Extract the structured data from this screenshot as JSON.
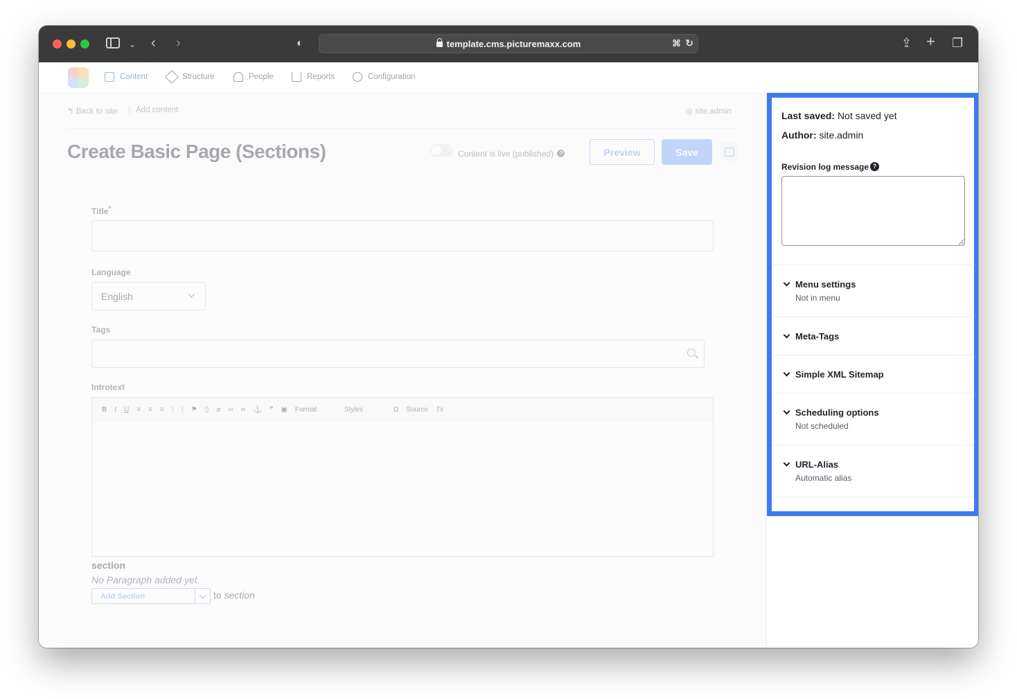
{
  "browser": {
    "url": "template.cms.picturemaxx.com"
  },
  "nav": {
    "items": [
      {
        "label": "Content",
        "icon": "document-icon",
        "active": true
      },
      {
        "label": "Structure",
        "icon": "layers-icon"
      },
      {
        "label": "People",
        "icon": "person-icon"
      },
      {
        "label": "Reports",
        "icon": "bar-chart-icon"
      },
      {
        "label": "Configuration",
        "icon": "gear-icon"
      }
    ]
  },
  "breadcrumb": {
    "back": "Back to site",
    "current": "Add content",
    "user": "site.admin"
  },
  "page": {
    "title": "Create Basic Page (Sections)",
    "live_label": "Content is live (published)",
    "preview_label": "Preview",
    "save_label": "Save"
  },
  "form": {
    "title_label": "Title",
    "title_required": "*",
    "language_label": "Language",
    "language_value": "English",
    "tags_label": "Tags",
    "introtext_label": "Introtext",
    "editor_toolbar": {
      "format": "Format",
      "styles": "Styles",
      "source": "Source"
    },
    "section_title": "section",
    "section_empty": "No Paragraph added yet.",
    "add_section_label": "Add Section",
    "to_label": "to",
    "to_target": "section"
  },
  "sidebar": {
    "last_saved_label": "Last saved:",
    "last_saved_value": "Not saved yet",
    "author_label": "Author:",
    "author_value": "site.admin",
    "revision_label": "Revision log message",
    "accordions": [
      {
        "title": "Menu settings",
        "subtitle": "Not in menu"
      },
      {
        "title": "Meta-Tags",
        "subtitle": ""
      },
      {
        "title": "Simple XML Sitemap",
        "subtitle": ""
      },
      {
        "title": "Scheduling options",
        "subtitle": "Not scheduled"
      },
      {
        "title": "URL-Alias",
        "subtitle": "Automatic alias"
      }
    ]
  },
  "colors": {
    "highlight": "#3e7bf2",
    "accent": "#7aa9f3"
  }
}
